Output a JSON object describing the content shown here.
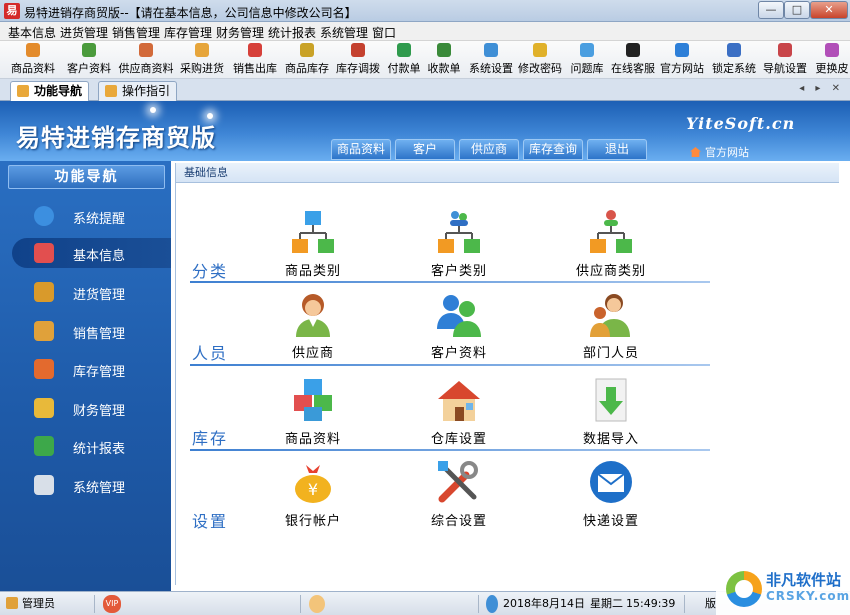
{
  "window": {
    "title": "易特进销存商贸版--【请在基本信息，公司信息中修改公司名】",
    "app_icon": "易",
    "controls": {
      "minimize": "—",
      "maximize": "□",
      "close": "✕"
    }
  },
  "menu": [
    "基本信息",
    "进货管理",
    "销售管理",
    "库存管理",
    "财务管理",
    "统计报表",
    "系统管理",
    "窗口"
  ],
  "toolbar": [
    {
      "label": "商品资料",
      "icon": "box-icon",
      "color": "#e38b2c"
    },
    {
      "label": "客户资料",
      "icon": "users-icon",
      "color": "#4b9b3c"
    },
    {
      "label": "供应商资料",
      "icon": "supplier-icon",
      "color": "#d26a3a"
    },
    {
      "label": "采购进货",
      "icon": "truck-icon",
      "color": "#e6a53b"
    },
    {
      "label": "销售出库",
      "icon": "cart-icon",
      "color": "#d6403a"
    },
    {
      "label": "商品库存",
      "icon": "stock-icon",
      "color": "#c9a227"
    },
    {
      "label": "库存调拨",
      "icon": "transfer-icon",
      "color": "#c4412f"
    },
    {
      "label": "付款单",
      "icon": "pay-icon",
      "color": "#2f9a4d"
    },
    {
      "label": "收款单",
      "icon": "receive-icon",
      "color": "#3a8a3a"
    },
    {
      "label": "系统设置",
      "icon": "settings-icon",
      "color": "#3f8fd6"
    },
    {
      "label": "修改密码",
      "icon": "key-icon",
      "color": "#e0b12a"
    },
    {
      "label": "问题库",
      "icon": "question-icon",
      "color": "#4a9ee0"
    },
    {
      "label": "在线客服",
      "icon": "qq-icon",
      "color": "#222222"
    },
    {
      "label": "官方网站",
      "icon": "ie-icon",
      "color": "#2d7fd8"
    },
    {
      "label": "锁定系统",
      "icon": "lock-icon",
      "color": "#3b6fc4"
    },
    {
      "label": "导航设置",
      "icon": "nav-icon",
      "color": "#c8454a"
    },
    {
      "label": "更换皮",
      "icon": "skin-icon",
      "color": "#b14fb8"
    }
  ],
  "tabs": [
    {
      "label": "功能导航",
      "active": true
    },
    {
      "label": "操作指引",
      "active": false
    }
  ],
  "tab_controls": "◂ ▸ ✕",
  "banner": {
    "title": "易特进销存商贸版",
    "brand": "YiteSoft.cn",
    "home_link": "官方网站",
    "nav": [
      "商品资料",
      "客户",
      "供应商",
      "库存查询",
      "退出"
    ]
  },
  "sidebar": {
    "header": "功能导航",
    "items": [
      {
        "label": "系统提醒",
        "icon": "info-icon",
        "color": "#3c8fe0",
        "active": false
      },
      {
        "label": "基本信息",
        "icon": "cubes-icon",
        "color": "#e24f4f",
        "active": true
      },
      {
        "label": "进货管理",
        "icon": "purchase-icon",
        "color": "#d99a2b",
        "active": false
      },
      {
        "label": "销售管理",
        "icon": "sales-icon",
        "color": "#e0a13a",
        "active": false
      },
      {
        "label": "库存管理",
        "icon": "warehouse-icon",
        "color": "#e36a2e",
        "active": false
      },
      {
        "label": "财务管理",
        "icon": "finance-icon",
        "color": "#e8b93a",
        "active": false
      },
      {
        "label": "统计报表",
        "icon": "chart-icon",
        "color": "#3da84a",
        "active": false
      },
      {
        "label": "系统管理",
        "icon": "tools-icon",
        "color": "#d8dfe8",
        "active": false
      }
    ]
  },
  "panel": {
    "header": "基础信息",
    "sections": [
      {
        "label": "分类",
        "items": [
          {
            "label": "商品类别",
            "icon": "category-tree-icon"
          },
          {
            "label": "客户类别",
            "icon": "customer-tree-icon"
          },
          {
            "label": "供应商类别",
            "icon": "supplier-tree-icon"
          }
        ]
      },
      {
        "label": "人员",
        "items": [
          {
            "label": "供应商",
            "icon": "supplier-person-icon"
          },
          {
            "label": "客户资料",
            "icon": "customers-icon"
          },
          {
            "label": "部门人员",
            "icon": "staff-icon"
          }
        ]
      },
      {
        "label": "库存",
        "items": [
          {
            "label": "商品资料",
            "icon": "cubes-icon"
          },
          {
            "label": "仓库设置",
            "icon": "house-icon"
          },
          {
            "label": "数据导入",
            "icon": "import-icon"
          }
        ]
      },
      {
        "label": "设置",
        "items": [
          {
            "label": "银行帐户",
            "icon": "money-bag-icon"
          },
          {
            "label": "综合设置",
            "icon": "tools-icon"
          },
          {
            "label": "快递设置",
            "icon": "express-icon"
          }
        ]
      }
    ]
  },
  "statusbar": {
    "user": "管理员",
    "badge": "VIP",
    "date": "2018年8月14日",
    "weekday": "星期二",
    "time": "15:49:39",
    "extra": "版"
  },
  "watermark": {
    "cn": "非凡软件站",
    "en": "CRSKY.com"
  }
}
